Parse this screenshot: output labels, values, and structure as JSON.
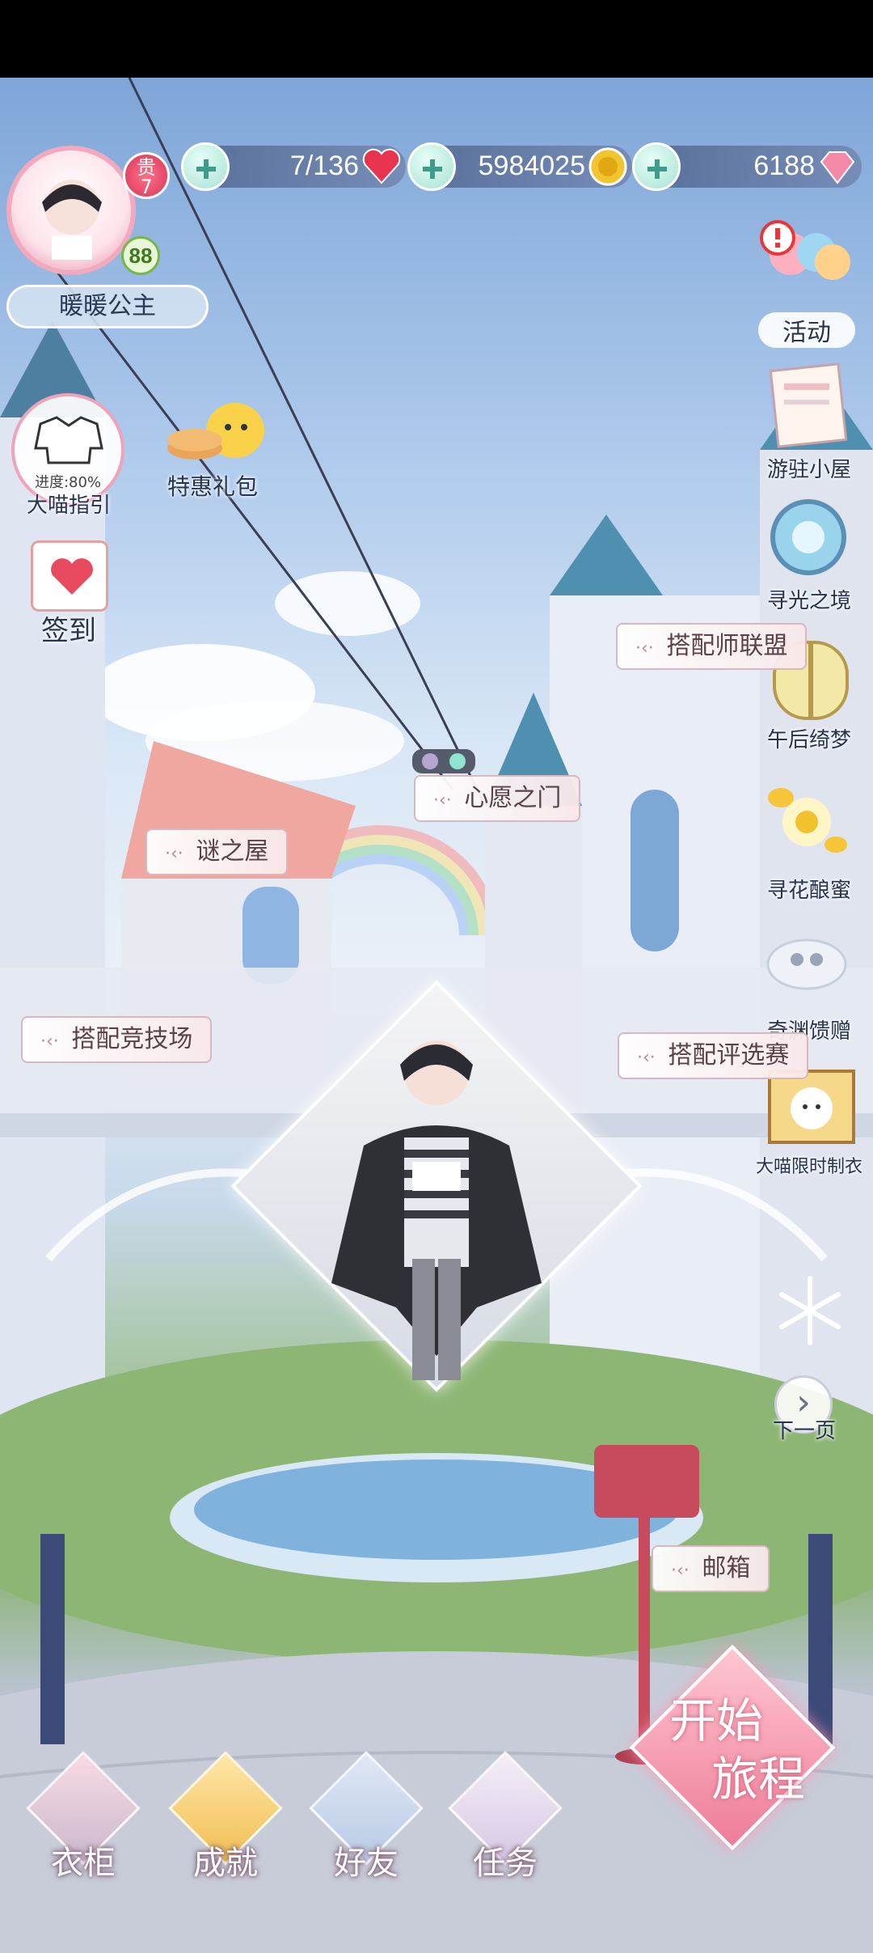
{
  "status_bar": {
    "stamina": "7/136",
    "gold": "5984025",
    "diamonds": "6188"
  },
  "profile": {
    "name": "暖暖公主",
    "vip_label": "贵",
    "vip_level": "7",
    "level": "88"
  },
  "left_menu": {
    "guide_progress": "进度:80%",
    "guide_label": "大喵指引",
    "gift_label": "特惠礼包",
    "signin_label": "签到"
  },
  "right_menu": [
    {
      "label": "活动"
    },
    {
      "label": "游驻小屋"
    },
    {
      "label": "寻光之境"
    },
    {
      "label": "午后绮梦"
    },
    {
      "label": "寻花酿蜜"
    },
    {
      "label": "奇渊馈赠"
    },
    {
      "label": "大喵限时制衣"
    }
  ],
  "scene_signs": {
    "stylist_alliance": "搭配师联盟",
    "wish_gate": "心愿之门",
    "mystery_house": "谜之屋",
    "arena": "搭配竞技场",
    "review": "搭配评选赛",
    "mailbox": "邮箱"
  },
  "next_page_label": "下一页",
  "bottom_nav": [
    {
      "label": "衣柜"
    },
    {
      "label": "成就"
    },
    {
      "label": "好友"
    },
    {
      "label": "任务"
    }
  ],
  "start_button": {
    "line1": "开始",
    "line2": "旅程"
  },
  "colors": {
    "accent_pink": "#ee7c98",
    "plus_teal": "#3f9c8a",
    "sky_blue": "#a9c6ea"
  }
}
